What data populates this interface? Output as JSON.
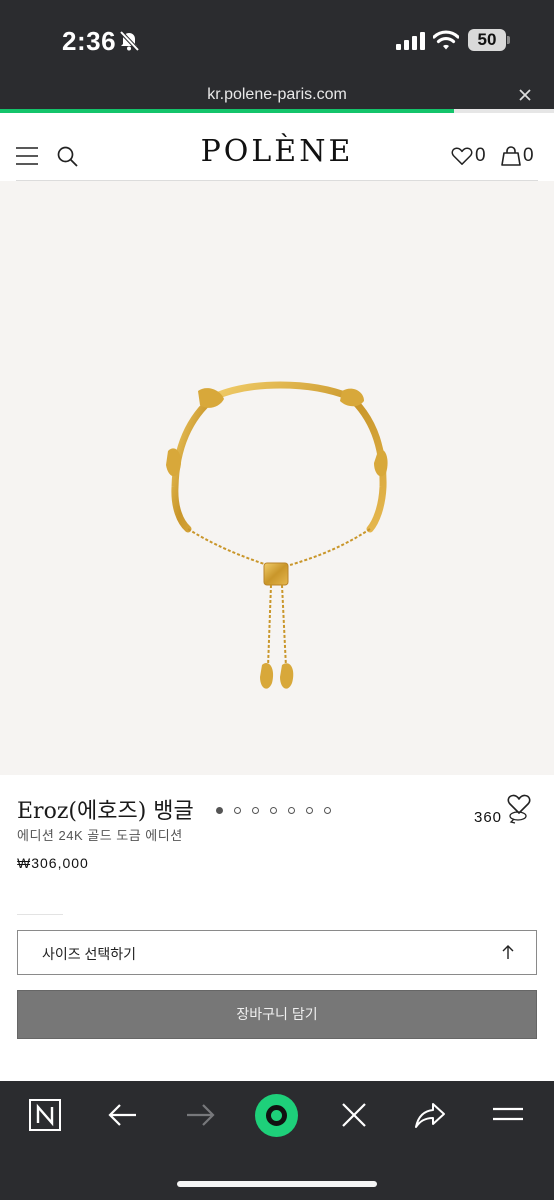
{
  "status_bar": {
    "time": "2:36",
    "battery": "50"
  },
  "browser": {
    "url": "kr.polene-paris.com",
    "load_progress": 0.82
  },
  "site": {
    "brand": "POLÈNE",
    "wishlist_count": "0",
    "cart_count": "0"
  },
  "product": {
    "image_count": 7,
    "active_image": 1,
    "view_360_label": "360",
    "title": "Eroz(에호즈) 뱅글",
    "subtitle": "에디션 24K 골드 도금 에디션",
    "price": "₩306,000",
    "size_select_label": "사이즈 선택하기",
    "add_to_cart_label": "장바구니 담기"
  },
  "colors": {
    "accent_green": "#1ed07a",
    "toolbar_bg": "#2b2c2f",
    "button_gray": "#777777",
    "media_bg": "#f6f4f2",
    "gold": "#d4a535"
  },
  "toolbar": {
    "icons": [
      "n-home-icon",
      "back-arrow-icon",
      "forward-arrow-icon",
      "green-circle-button",
      "close-icon",
      "share-icon",
      "menu-icon"
    ]
  }
}
